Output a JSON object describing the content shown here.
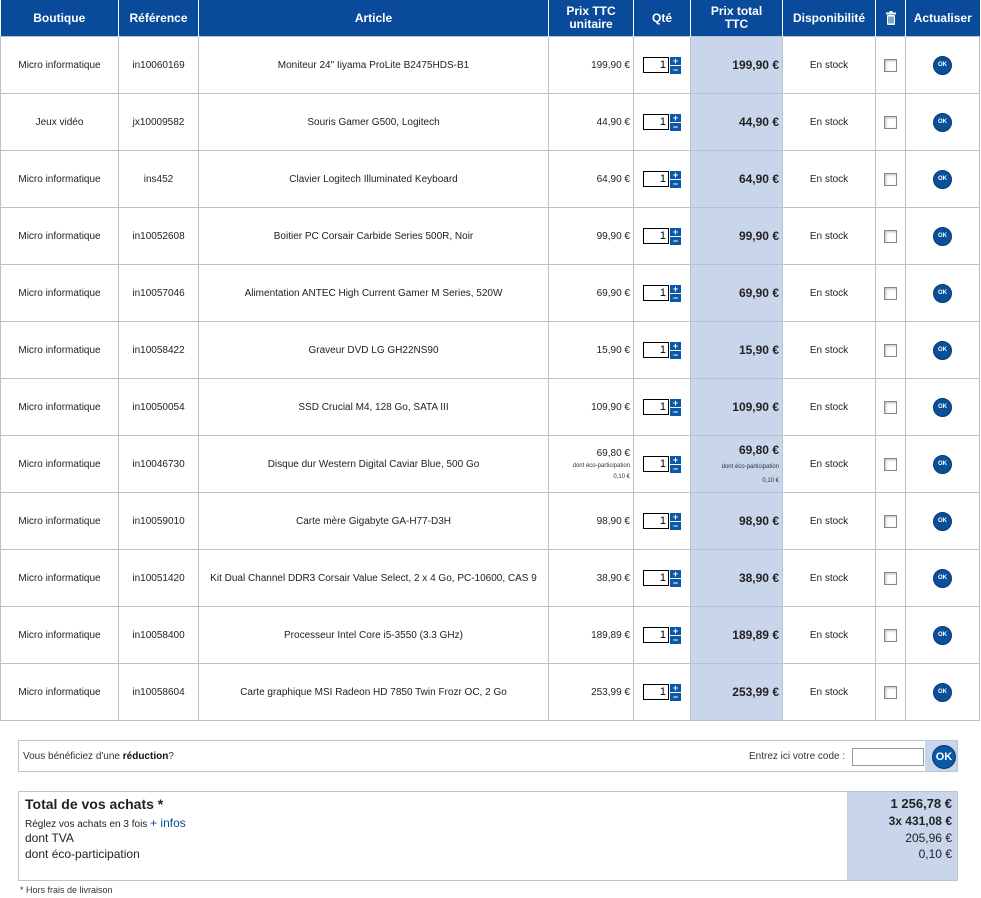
{
  "headers": {
    "boutique": "Boutique",
    "reference": "Référence",
    "article": "Article",
    "unit_price_1": "Prix TTC",
    "unit_price_2": "unitaire",
    "qty": "Qté",
    "total_1": "Prix total",
    "total_2": "TTC",
    "availability": "Disponibilité",
    "delete_icon": "trash-icon",
    "update": "Actualiser"
  },
  "ok_label": "OK",
  "eco_label": "dont éco-participation",
  "rows": [
    {
      "boutique": "Micro informatique",
      "ref": "in10060169",
      "article": "Moniteur 24\" Iiyama ProLite B2475HDS-B1",
      "unit": "199,90 €",
      "qty": "1",
      "total": "199,90 €",
      "dispo": "En stock"
    },
    {
      "boutique": "Jeux vidéo",
      "ref": "jx10009582",
      "article": "Souris Gamer G500, Logitech",
      "unit": "44,90 €",
      "qty": "1",
      "total": "44,90 €",
      "dispo": "En stock"
    },
    {
      "boutique": "Micro informatique",
      "ref": "ins452",
      "article": "Clavier Logitech Illuminated Keyboard",
      "unit": "64,90 €",
      "qty": "1",
      "total": "64,90 €",
      "dispo": "En stock"
    },
    {
      "boutique": "Micro informatique",
      "ref": "in10052608",
      "article": "Boitier PC Corsair Carbide Series 500R, Noir",
      "unit": "99,90 €",
      "qty": "1",
      "total": "99,90 €",
      "dispo": "En stock"
    },
    {
      "boutique": "Micro informatique",
      "ref": "in10057046",
      "article": "Alimentation ANTEC High Current Gamer M Series, 520W",
      "unit": "69,90 €",
      "qty": "1",
      "total": "69,90 €",
      "dispo": "En stock"
    },
    {
      "boutique": "Micro informatique",
      "ref": "in10058422",
      "article": "Graveur DVD LG GH22NS90",
      "unit": "15,90 €",
      "qty": "1",
      "total": "15,90 €",
      "dispo": "En stock"
    },
    {
      "boutique": "Micro informatique",
      "ref": "in10050054",
      "article": "SSD Crucial M4, 128 Go, SATA III",
      "unit": "109,90 €",
      "qty": "1",
      "total": "109,90 €",
      "dispo": "En stock"
    },
    {
      "boutique": "Micro informatique",
      "ref": "in10046730",
      "article": "Disque dur Western Digital Caviar Blue, 500 Go",
      "unit": "69,80 €",
      "eco": "0,10 €",
      "qty": "1",
      "total": "69,80 €",
      "dispo": "En stock"
    },
    {
      "boutique": "Micro informatique",
      "ref": "in10059010",
      "article": "Carte mère Gigabyte GA-H77-D3H",
      "unit": "98,90 €",
      "qty": "1",
      "total": "98,90 €",
      "dispo": "En stock"
    },
    {
      "boutique": "Micro informatique",
      "ref": "in10051420",
      "article": "Kit Dual Channel DDR3 Corsair Value Select, 2 x 4 Go, PC-10600, CAS 9",
      "unit": "38,90 €",
      "qty": "1",
      "total": "38,90 €",
      "dispo": "En stock"
    },
    {
      "boutique": "Micro informatique",
      "ref": "in10058400",
      "article": "Processeur Intel Core i5-3550 (3.3 GHz)",
      "unit": "189,89 €",
      "qty": "1",
      "total": "189,89 €",
      "dispo": "En stock"
    },
    {
      "boutique": "Micro informatique",
      "ref": "in10058604",
      "article": "Carte graphique MSI Radeon HD 7850 Twin Frozr OC, 2 Go",
      "unit": "253,99 €",
      "qty": "1",
      "total": "253,99 €",
      "dispo": "En stock"
    }
  ],
  "promo": {
    "text_before": "Vous bénéficiez d'une ",
    "text_bold": "réduction",
    "text_after": "?",
    "label": "Entrez ici votre code :",
    "ok": "OK"
  },
  "summary": {
    "title": "Total de vos achats *",
    "installment_text": "Réglez vos achats en 3 fois ",
    "installment_link": "+ infos",
    "tva_label": "dont TVA",
    "eco_label": "dont éco-participation",
    "total": "1 256,78 €",
    "installment_value": "3x  431,08 €",
    "tva_value": "205,96 €",
    "eco_value": "0,10 €"
  },
  "footnote": "* Hors frais de livraison",
  "colors": {
    "header_blue": "#0a4a9a",
    "total_column": "#c8d5ea"
  }
}
